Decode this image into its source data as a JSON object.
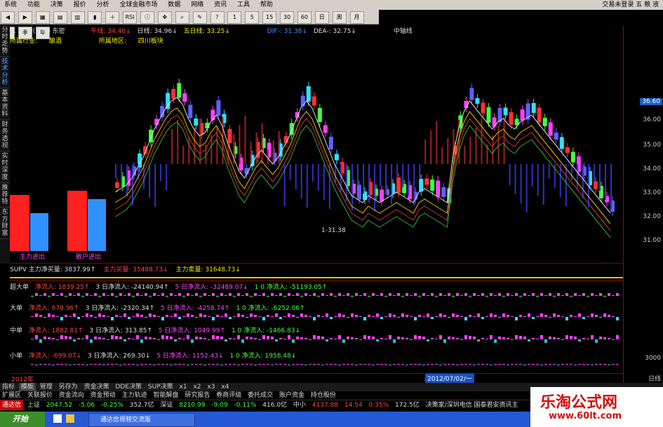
{
  "menubar": {
    "items": [
      "系统",
      "功能",
      "决策",
      "报价",
      "分析",
      "全球金融市场",
      "数据",
      "网络",
      "资讯",
      "工具",
      "帮助"
    ],
    "right_text": "交易未登录  五 粮 液"
  },
  "toolbar": {
    "buttons": [
      "RSI",
      "1",
      "5",
      "15",
      "30",
      "60",
      "日",
      "周",
      "月",
      "多",
      "季",
      "年"
    ]
  },
  "chart_header": {
    "title": "五 粮 液(日线) 东密",
    "ma_labels": [
      "午线: 34.40↓",
      "日线: 34.96↓",
      "五日线: 33.25↓"
    ],
    "macd_labels": [
      "DIF-: 31.38↓",
      "DEA-: 32.75↓"
    ],
    "right_label": "中轴线",
    "industry_label": "所属行业:",
    "industry_value": "酿酒",
    "region_label": "所属地区:",
    "region_value": "四川板块"
  },
  "sidetabs": [
    "分时走势",
    "技术分析",
    "基本资料",
    "财务透视",
    "实时深度",
    "推荐特",
    "东方财富"
  ],
  "price_axis": {
    "current": "36.60",
    "ticks": [
      "36.00",
      "35.00",
      "34.00",
      "33.00",
      "32.00",
      "31.00"
    ]
  },
  "overlay_labels": {
    "bar_left": "主力进出",
    "bar_right": "散户进出",
    "macd_val": "1-31.38"
  },
  "panels": [
    {
      "name": "SUPV",
      "items": [
        "SUPV 主力净买量: 3837.99↑",
        "主力买量: 35488.73↓",
        "主力卖量: 31648.73↓"
      ]
    },
    {
      "name": "超大单",
      "items": [
        "超大单",
        "净流入: 1839.25↑",
        "3 日净流入: -24140.94↑",
        "5 日净流入: -32489.07↓",
        "1 0 净流入: -51193.05↑"
      ]
    },
    {
      "name": "大单",
      "items": [
        "大单",
        "净流入: 678.96↑",
        "3 日净流入: -2320.34↑",
        "5 日净流入: -4258.74↑",
        "1 0 净流入: -6252.06↑"
      ]
    },
    {
      "name": "中单",
      "items": [
        "中单",
        "净流入: 1882.81↑",
        "3 日净流入: 313.85↑",
        "5 日净流入: 1049.99↑",
        "1 0 净流入: -1466.83↓"
      ]
    },
    {
      "name": "小单",
      "items": [
        "小单",
        "净流入: -699.07↓",
        "3 日净流入: 269.30↓",
        "5 日净流入: 1152.43↓",
        "1 0 净流入: 1958.48↓"
      ]
    }
  ],
  "lower_axis": {
    "ticks": [
      "3000"
    ],
    "period": "日线",
    "date_marker": "2012/07/02/一",
    "year_left": "2012年"
  },
  "bottom_tabs": [
    "指标",
    "模板",
    "管理",
    "另存为",
    "资金决策",
    "DDE决策",
    "SUP决策",
    "x1",
    "x2",
    "x3",
    "x4"
  ],
  "link_bar": [
    "扩展区",
    "关联报价",
    "资金流向",
    "资金预动",
    "主力轨迹",
    "智能解盘",
    "研究报告",
    "券商评级",
    "委托成交",
    "账户资金",
    "持仓股份"
  ],
  "status_bar": {
    "app": "通达信",
    "items": [
      {
        "label": "上证",
        "value": "2047.52",
        "chg": "-5.06",
        "pct": "-0.25%",
        "vol": "352.7亿"
      },
      {
        "label": "深证",
        "value": "8210.99",
        "chg": "-9.09",
        "pct": "-0.11%",
        "vol": "416.0亿"
      },
      {
        "label": "中小",
        "value": "4137.88",
        "chg": "14.54",
        "pct": "0.35%",
        "vol": "172.5亿"
      }
    ],
    "right_text": "决策家/深圳电信  国泰君安资讯主"
  },
  "taskbar": {
    "start": "开始",
    "item": "通达信视频交流版"
  },
  "watermark": {
    "line1": "乐淘公式网",
    "line2": "www.60lt.com"
  },
  "colors": {
    "up": "#ff3030",
    "down": "#30e0ff",
    "magenta": "#ff40ff",
    "green": "#40ff40",
    "bg": "#000000"
  }
}
